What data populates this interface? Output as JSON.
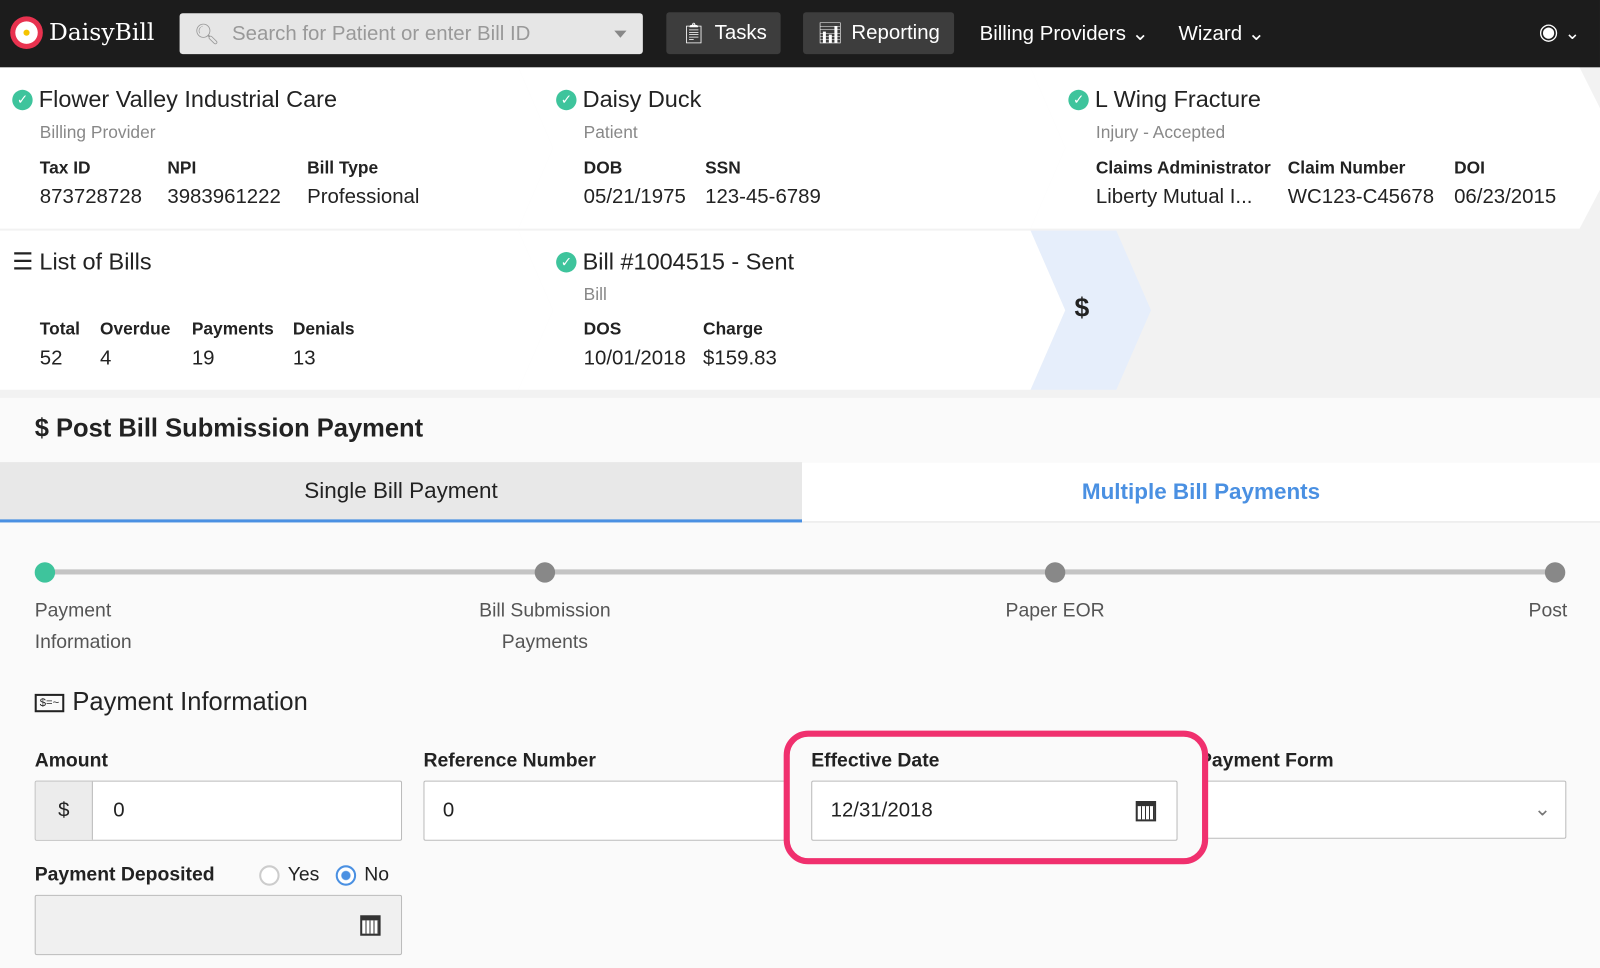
{
  "nav": {
    "brand": "DaisyBill",
    "search_placeholder": "Search for Patient or enter Bill ID",
    "tasks": "Tasks",
    "reporting": "Reporting",
    "billing_providers": "Billing Providers",
    "wizard": "Wizard"
  },
  "provider": {
    "name": "Flower Valley Industrial Care",
    "subtitle": "Billing Provider",
    "tax_id_label": "Tax ID",
    "tax_id": "873728728",
    "npi_label": "NPI",
    "npi": "3983961222",
    "bill_type_label": "Bill Type",
    "bill_type": "Professional"
  },
  "patient": {
    "name": "Daisy Duck",
    "subtitle": "Patient",
    "dob_label": "DOB",
    "dob": "05/21/1975",
    "ssn_label": "SSN",
    "ssn": "123-45-6789"
  },
  "injury": {
    "name": "L Wing Fracture",
    "subtitle": "Injury - Accepted",
    "claims_admin_label": "Claims Administrator",
    "claims_admin": "Liberty Mutual I...",
    "claim_number_label": "Claim Number",
    "claim_number": "WC123-C45678",
    "doi_label": "DOI",
    "doi": "06/23/2015"
  },
  "bills": {
    "title": "List of Bills",
    "total_label": "Total",
    "total": "52",
    "overdue_label": "Overdue",
    "overdue": "4",
    "payments_label": "Payments",
    "payments": "19",
    "denials_label": "Denials",
    "denials": "13"
  },
  "bill": {
    "title": "Bill #1004515 - Sent",
    "subtitle": "Bill",
    "dos_label": "DOS",
    "dos": "10/01/2018",
    "charge_label": "Charge",
    "charge": "$159.83",
    "dollar": "$"
  },
  "page": {
    "title": "$ Post Bill Submission Payment",
    "tabs": [
      "Single Bill Payment",
      "Multiple Bill Payments"
    ]
  },
  "steps": [
    "Payment\nInformation",
    "Bill Submission\nPayments",
    "Paper EOR",
    "Post"
  ],
  "form": {
    "section": "Payment Information",
    "amount_label": "Amount",
    "amount_prefix": "$",
    "amount": "0",
    "ref_label": "Reference Number",
    "ref": "0",
    "eff_label": "Effective Date",
    "eff": "12/31/2018",
    "form_label": "Payment Form",
    "deposited_label": "Payment Deposited",
    "yes": "Yes",
    "no": "No"
  },
  "colors": {
    "accent": "#4a90e2",
    "highlight": "#f0306e",
    "check": "#3ec49c"
  }
}
